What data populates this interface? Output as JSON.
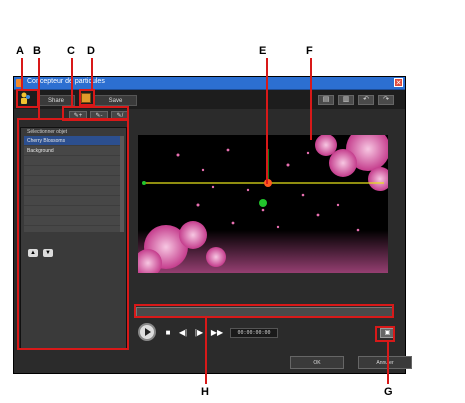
{
  "callouts": {
    "a": "A",
    "b": "B",
    "c": "C",
    "d": "D",
    "e": "E",
    "f": "F",
    "g": "G",
    "h": "H"
  },
  "window": {
    "title": "Concepteur de particules",
    "close_glyph": "✕"
  },
  "toolbar": {
    "share_label": "Share",
    "save_label": "Save",
    "right_icons": [
      "▤",
      "▥",
      "↶",
      "↷"
    ]
  },
  "subtools": [
    "✎+",
    "✎-",
    "✎/"
  ],
  "object_panel": {
    "label": "Sélectionner objet",
    "items": [
      "Cherry Blossoms",
      "Background"
    ],
    "up_glyph": "▲",
    "down_glyph": "▼"
  },
  "playback": {
    "timecode": "00:00:00:00",
    "stop_glyph": "■",
    "prev_glyph": "◀|",
    "next_glyph": "|▶",
    "ff_glyph": "▶▶",
    "screen_glyph": "▣"
  },
  "dialog": {
    "ok_label": "OK",
    "cancel_label": "Annuler"
  },
  "colors": {
    "accent": "#d81919",
    "particle_pink": "#e76fb0",
    "path_line": "#e6e21a",
    "green_handle": "#22c42c",
    "orange_handle": "#ff5a1f"
  }
}
